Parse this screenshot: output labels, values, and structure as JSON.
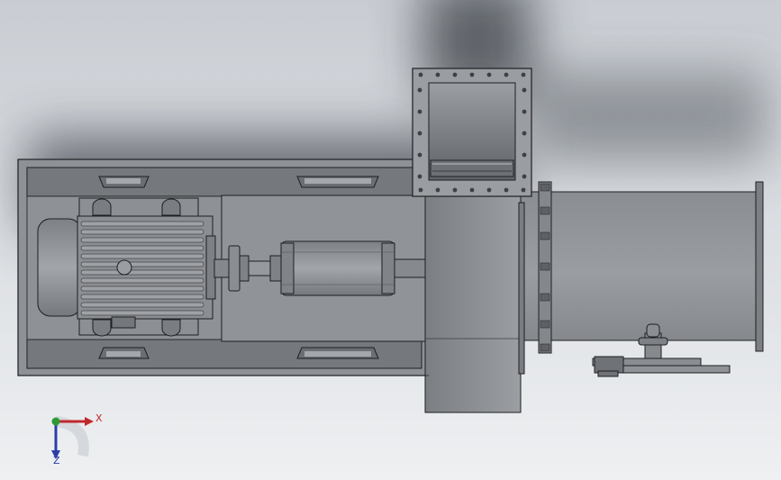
{
  "viewport": {
    "background_top": "#cfd3d8",
    "background_bottom": "#eef0f2",
    "shadow_color": "#3c4048"
  },
  "model": {
    "name": "",
    "body_color": "#8f9296",
    "dark_color": "#6f7276",
    "edge_color": "#1e1f22",
    "highlight_color": "#b3b6ba",
    "parts": [
      {
        "id": "base-frame",
        "label": ""
      },
      {
        "id": "motor",
        "label": ""
      },
      {
        "id": "coupling",
        "label": ""
      },
      {
        "id": "bearing-housing",
        "label": ""
      },
      {
        "id": "fan-housing",
        "label": ""
      },
      {
        "id": "inlet-flange",
        "label": ""
      },
      {
        "id": "outlet-duct",
        "label": ""
      },
      {
        "id": "drain-valve",
        "label": ""
      }
    ]
  },
  "triad": {
    "x_label": "X",
    "z_label": "Z",
    "x_color": "#c0282d",
    "y_color": "#2f9a35",
    "z_color": "#2b3ea8"
  }
}
